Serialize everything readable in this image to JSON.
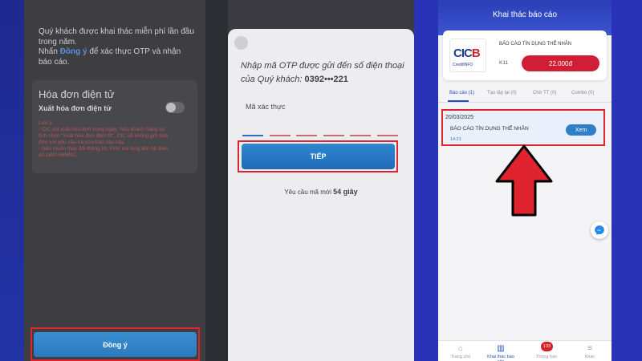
{
  "panel1": {
    "intro_line1": "Quý khách được khai thác miễn phí lần đầu trong năm.",
    "intro_prefix": "Nhấn ",
    "intro_highlight": "Đồng ý",
    "intro_suffix": " để xác thực OTP và nhận báo cáo.",
    "invoice_title": "Hóa đơn điện tử",
    "invoice_toggle_label": "Xuất hóa đơn điện tử",
    "notes": [
      "Lưu ý:",
      "- CIC chỉ xuất hóa đơn trong ngày. Nếu khách hàng bỏ",
      "tích chọn \"Xuất hóa đơn điện tử\", CIC sẽ không gửi hóa",
      "đơn với yêu cầu tra cứu báo cáo này.",
      "- Nếu muốn thay đổi thông tin, KHV vui lòng liên hệ theo",
      "số 1800 585891."
    ],
    "confirm_label": "Đồng ý"
  },
  "panel2": {
    "otp_text": "Nhập mã OTP được gửi đến số điện thoại của Quý khách: ",
    "otp_phone": "0392•••221",
    "code_label": "Mã xác thực",
    "next_label": "TIẾP",
    "resend_prefix": "Yêu cầu mã mới ",
    "resend_countdown": "54 giây"
  },
  "panel3": {
    "header_title": "Khai thác báo cáo",
    "product_name": "BÁO CÁO TÍN DỤNG THỂ NHÂN",
    "product_code": "K11",
    "price": "22.000đ",
    "logo_text_a": "CIC",
    "logo_text_b": "B",
    "logo_sub": "CreditINFO",
    "tabs": [
      {
        "label": "Báo cáo (1)"
      },
      {
        "label": "Tạo lập lại (0)"
      },
      {
        "label": "Chờ TT (0)"
      },
      {
        "label": "Combo (0)"
      }
    ],
    "report": {
      "date": "20/03/2025",
      "title": "BÁO CÁO TÍN DỤNG THỂ NHÂN",
      "time": "14:21",
      "view_label": "Xem"
    },
    "nav": [
      {
        "label": "Trang chủ",
        "icon": "home-icon",
        "glyph": "⌂"
      },
      {
        "label": "Khai thác báo cáo",
        "icon": "chart-icon",
        "glyph": "▥"
      },
      {
        "label": "Thông báo",
        "icon": "bell-icon",
        "glyph": "🔔"
      },
      {
        "label": "Khác",
        "icon": "menu-icon",
        "glyph": "≡"
      }
    ],
    "notification_count": "133"
  },
  "colors": {
    "highlight_frame": "#e0242f",
    "primary_blue": "#2a79c0",
    "brand_red": "#cf1e35",
    "header_blue": "#2b3fb6"
  }
}
